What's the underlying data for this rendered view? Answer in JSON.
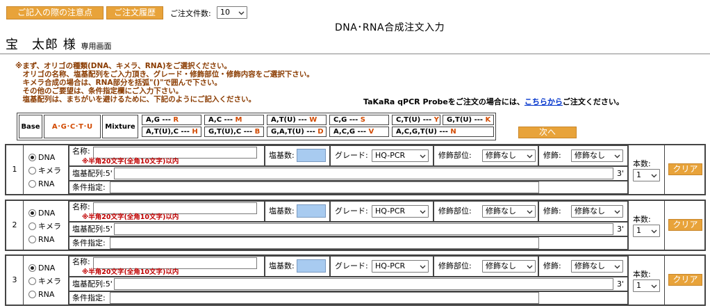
{
  "header": {
    "btn_notes": "ご記入の際の注意点",
    "btn_history": "ご注文履歴",
    "count_label": "ご注文件数:",
    "count_value": "10",
    "title": "DNA･RNA合成注文入力",
    "user_name": "宝　太郎 様",
    "user_suffix": "専用画面"
  },
  "notes": [
    "※まず、オリゴの種類(DNA、キメラ、RNA)をご選択ください。",
    "　オリゴの名称、塩基配列をご入力頂き、グレード・修飾部位・修飾内容をご選択下さい。",
    "　キメラ合成の場合は、RNA部分を括弧\"()\"で囲んで下さい。",
    "　その他のご要望は、条件指定欄にご入力下さい。",
    "　塩基配列は、まちがいを避けるために、下記のようにご記入ください。"
  ],
  "probe": {
    "prefix": "TaKaRa qPCR Probeをご注文の場合には、",
    "link": "こちらから",
    "suffix": "ご注文ください。"
  },
  "code_table": {
    "base": "Base",
    "bases": "A･G･C･T･U",
    "mixture": "Mixture",
    "items": [
      {
        "combo": "A,G --- ",
        "code": "R"
      },
      {
        "combo": "A,C --- ",
        "code": "M"
      },
      {
        "combo": "A,T(U) --- ",
        "code": "W"
      },
      {
        "combo": "C,G --- ",
        "code": "S"
      },
      {
        "combo": "C,T(U) --- ",
        "code": "Y"
      },
      {
        "combo": "G,T(U) --- ",
        "code": "K"
      },
      {
        "combo": "A,T(U),C --- ",
        "code": "H"
      },
      {
        "combo": "G,T(U),C --- ",
        "code": "B"
      },
      {
        "combo": "G,A,T(U) --- ",
        "code": "D"
      },
      {
        "combo": "A,C,G --- ",
        "code": "V"
      },
      {
        "combo": "A,C,G,T(U) --- ",
        "code": "N"
      }
    ]
  },
  "next_label": "次へ",
  "labels": {
    "type_dna": "DNA",
    "type_chimera": "キメラ",
    "type_rna": "RNA",
    "name": "名称:",
    "name_warning": "※半角20文字(全角10文字)以内",
    "base_count": "塩基数:",
    "grade": "グレード:",
    "mod_site": "修飾部位:",
    "mod": "修飾:",
    "sequence": "塩基配列:5'",
    "three_prime": "3'",
    "conditions": "条件指定:",
    "quantity": "本数:",
    "clear": "クリア"
  },
  "orders": [
    {
      "no": "1",
      "type": "DNA",
      "grade": "HQ-PCR",
      "mod_site": "修飾なし",
      "mod": "修飾なし",
      "quantity": "1"
    },
    {
      "no": "2",
      "type": "DNA",
      "grade": "HQ-PCR",
      "mod_site": "修飾なし",
      "mod": "修飾なし",
      "quantity": "1"
    },
    {
      "no": "3",
      "type": "DNA",
      "grade": "HQ-PCR",
      "mod_site": "修飾なし",
      "mod": "修飾なし",
      "quantity": "1"
    }
  ],
  "colors": {
    "button": "#e8a33a",
    "notes": "#8a3b00",
    "warning": "#c00000",
    "link": "#0033cc",
    "base_count_field": "#a8cbf0"
  }
}
